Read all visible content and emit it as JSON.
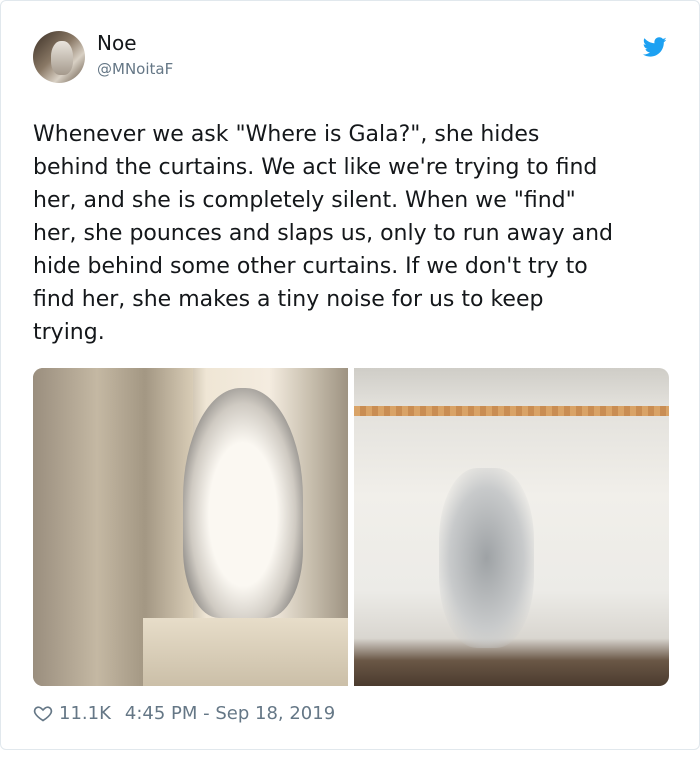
{
  "user": {
    "name": "Noe",
    "handle": "@MNoitaF"
  },
  "tweet": {
    "text": "Whenever we ask \"Where is Gala?\", she hides\nbehind the curtains. We act like we're trying to find\nher, and she is completely silent. When we \"find\"\nher, she pounces and slaps us, only to run away and\nhide behind some other curtains. If we don't try to\nfind her, she makes a tiny noise for us to keep\ntrying."
  },
  "meta": {
    "likes": "11.1K",
    "timestamp": "4:45 PM - Sep 18, 2019"
  },
  "colors": {
    "twitter_blue": "#1da1f2",
    "muted_text": "#657786"
  },
  "icons": {
    "brand": "twitter-bird-icon",
    "like": "heart-outline-icon"
  }
}
